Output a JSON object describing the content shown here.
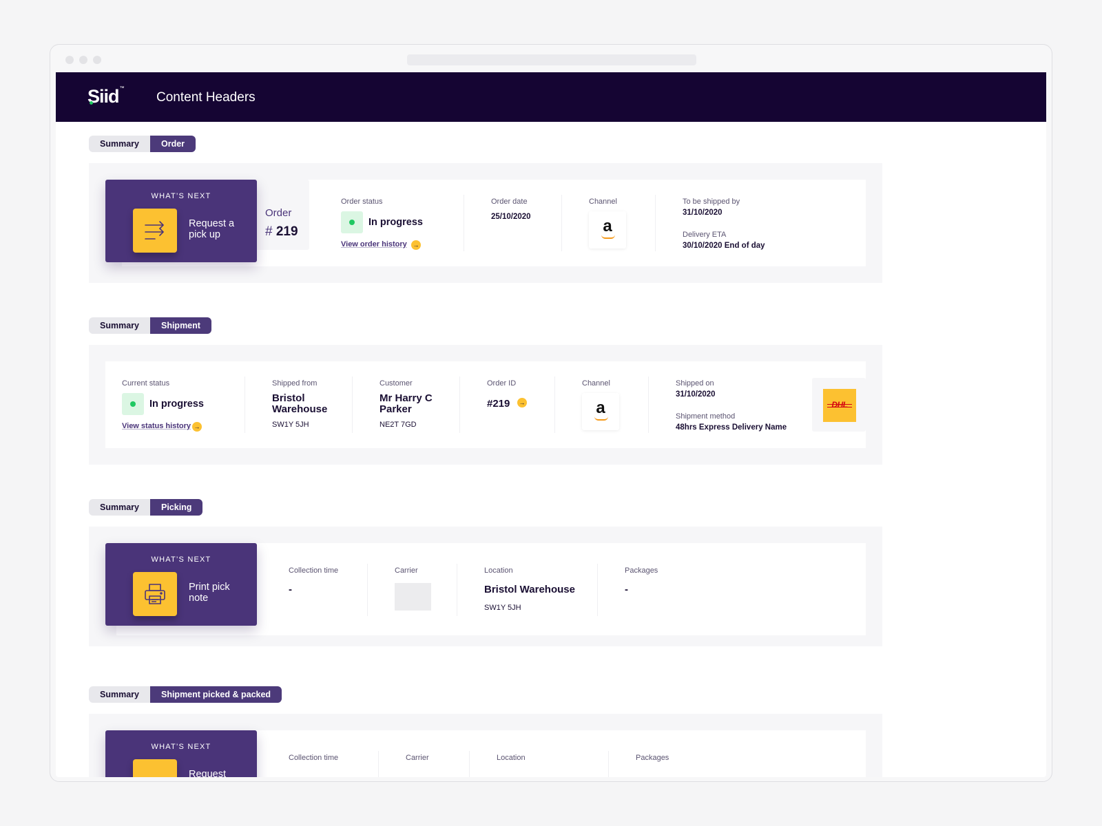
{
  "app": {
    "logo": "Siid",
    "logo_mark": "™",
    "title": "Content Headers"
  },
  "tabs": {
    "order": [
      "Summary",
      "Order"
    ],
    "shipment": [
      "Summary",
      "Shipment"
    ],
    "picking": [
      "Summary",
      "Picking"
    ],
    "packed": [
      "Summary",
      "Shipment picked & packed"
    ]
  },
  "order_section": {
    "whats_next": {
      "label": "WHAT’S NEXT",
      "action": "Request a pick up",
      "icon": "arrows-icon"
    },
    "order_word": "Order",
    "order_hash": "#",
    "order_number": "219",
    "order_status": {
      "label": "Order status",
      "value": "In progress",
      "link": "View order history"
    },
    "order_date": {
      "label": "Order date",
      "value": "25/10/2020"
    },
    "channel": {
      "label": "Channel",
      "logo": "a"
    },
    "ship_by": {
      "label": "To be shipped by",
      "value": "31/10/2020"
    },
    "delivery_eta": {
      "label": "Delivery ETA",
      "value": "30/10/2020 End of day"
    }
  },
  "shipment_section": {
    "current_status": {
      "label": "Current status",
      "value": "In progress",
      "link": "View status history"
    },
    "shipped_from": {
      "label": "Shipped from",
      "line1": "Bristol",
      "line2": "Warehouse",
      "postcode": "SW1Y 5JH"
    },
    "customer": {
      "label": "Customer",
      "line1": "Mr Harry C",
      "line2": "Parker",
      "postcode": "NE2T 7GD"
    },
    "order_id": {
      "label": "Order ID",
      "value": "#219"
    },
    "channel": {
      "label": "Channel",
      "logo": "a"
    },
    "shipped_on": {
      "label": "Shipped on",
      "value": "31/10/2020"
    },
    "shipment_method": {
      "label": "Shipment method",
      "value": "48hrs Express Delivery Name"
    },
    "carrier_logo": "DHL"
  },
  "picking_section": {
    "whats_next": {
      "label": "WHAT’S NEXT",
      "action": "Print pick note",
      "icon": "printer-icon"
    },
    "collection_time": {
      "label": "Collection time",
      "value": "-"
    },
    "carrier": {
      "label": "Carrier"
    },
    "location": {
      "label": "Location",
      "value": "Bristol Warehouse",
      "postcode": "SW1Y 5JH"
    },
    "packages": {
      "label": "Packages",
      "value": "-"
    }
  },
  "packed_section": {
    "whats_next": {
      "label": "WHAT’S NEXT",
      "action": "Request"
    },
    "collection_time": {
      "label": "Collection time"
    },
    "carrier": {
      "label": "Carrier"
    },
    "location": {
      "label": "Location"
    },
    "packages": {
      "label": "Packages"
    }
  },
  "colors": {
    "appbar": "#150533",
    "accent": "#4a3479",
    "highlight": "#fcc131",
    "status_green": "#20c862"
  }
}
